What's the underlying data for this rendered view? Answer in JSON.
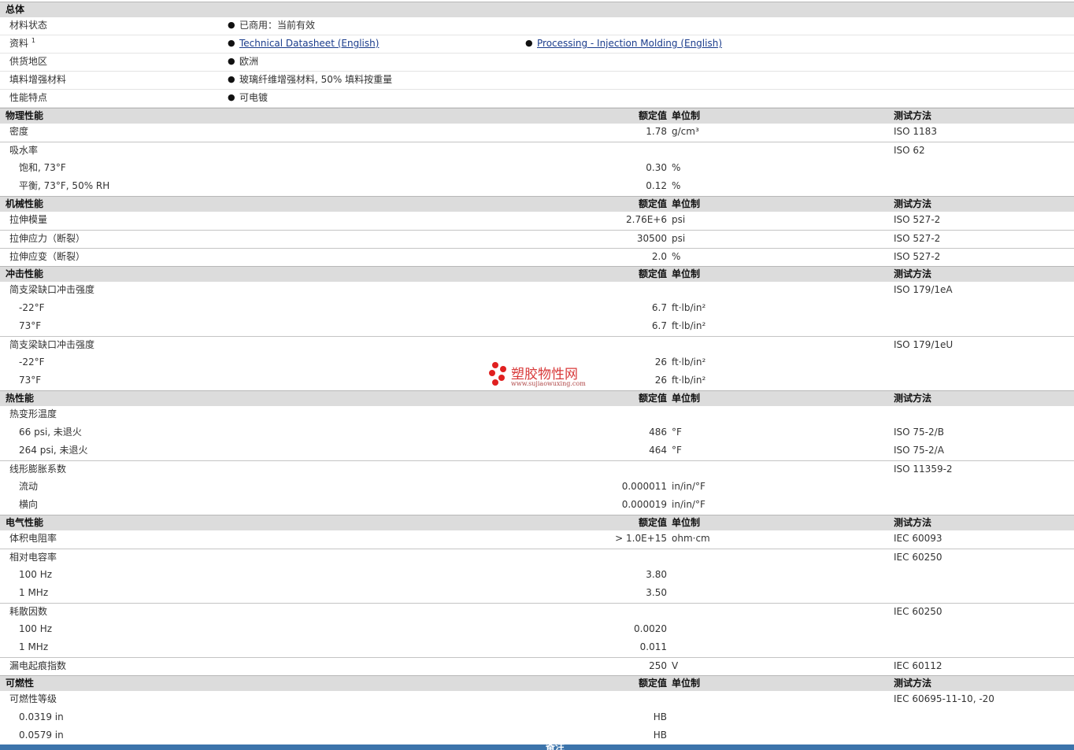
{
  "general": {
    "title": "总体",
    "rows": [
      {
        "label": "材料状态",
        "items": [
          "已商用：当前有效"
        ]
      },
      {
        "label": "资料",
        "sup": "1",
        "links": [
          "Technical Datasheet (English)",
          "Processing - Injection Molding (English)"
        ]
      },
      {
        "label": "供货地区",
        "items": [
          "欧洲"
        ]
      },
      {
        "label": "填料增强材料",
        "items": [
          "玻璃纤维增强材料, 50% 填料按重量"
        ]
      },
      {
        "label": "性能特点",
        "items": [
          "可电镀"
        ]
      }
    ]
  },
  "columns": {
    "value": "额定值",
    "unit": "单位制",
    "method": "测试方法"
  },
  "bullet_icon": "bullet-dot-icon",
  "sections": [
    {
      "title": "物理性能",
      "rows": [
        {
          "name": "密度",
          "value": "1.78",
          "unit": "g/cm³",
          "method": "ISO 1183"
        },
        {
          "name": "吸水率",
          "method": "ISO 62"
        },
        {
          "name": "饱和, 73°F",
          "sub": true,
          "value": "0.30",
          "unit": "%"
        },
        {
          "name": "平衡, 73°F, 50% RH",
          "sub": true,
          "value": "0.12",
          "unit": "%"
        }
      ]
    },
    {
      "title": "机械性能",
      "rows": [
        {
          "name": "拉伸模量",
          "value": "2.76E+6",
          "unit": "psi",
          "method": "ISO 527-2"
        },
        {
          "name": "拉伸应力（断裂）",
          "value": "30500",
          "unit": "psi",
          "method": "ISO 527-2"
        },
        {
          "name": "拉伸应变（断裂）",
          "value": "2.0",
          "unit": "%",
          "method": "ISO 527-2"
        }
      ]
    },
    {
      "title": "冲击性能",
      "rows": [
        {
          "name": "简支梁缺口冲击强度",
          "method": "ISO 179/1eA"
        },
        {
          "name": "-22°F",
          "sub": true,
          "value": "6.7",
          "unit": "ft·lb/in²"
        },
        {
          "name": "73°F",
          "sub": true,
          "value": "6.7",
          "unit": "ft·lb/in²"
        },
        {
          "name": "简支梁缺口冲击强度",
          "method": "ISO 179/1eU"
        },
        {
          "name": "-22°F",
          "sub": true,
          "value": "26",
          "unit": "ft·lb/in²"
        },
        {
          "name": "73°F",
          "sub": true,
          "value": "26",
          "unit": "ft·lb/in²"
        }
      ]
    },
    {
      "title": "热性能",
      "rows": [
        {
          "name": "热变形温度"
        },
        {
          "name": "66 psi, 未退火",
          "sub": true,
          "value": "486",
          "unit": "°F",
          "method": "ISO 75-2/B"
        },
        {
          "name": "264 psi, 未退火",
          "sub": true,
          "value": "464",
          "unit": "°F",
          "method": "ISO 75-2/A"
        },
        {
          "name": "线形膨胀系数",
          "method": "ISO 11359-2"
        },
        {
          "name": "流动",
          "sub": true,
          "value": "0.000011",
          "unit": "in/in/°F"
        },
        {
          "name": "横向",
          "sub": true,
          "value": "0.000019",
          "unit": "in/in/°F"
        }
      ]
    },
    {
      "title": "电气性能",
      "rows": [
        {
          "name": "体积电阻率",
          "value": "> 1.0E+15",
          "unit": "ohm·cm",
          "method": "IEC 60093"
        },
        {
          "name": "相对电容率",
          "method": "IEC 60250"
        },
        {
          "name": "100 Hz",
          "sub": true,
          "value": "3.80"
        },
        {
          "name": "1 MHz",
          "sub": true,
          "value": "3.50"
        },
        {
          "name": "耗散因数",
          "method": "IEC 60250"
        },
        {
          "name": "100 Hz",
          "sub": true,
          "value": "0.0020"
        },
        {
          "name": "1 MHz",
          "sub": true,
          "value": "0.011"
        },
        {
          "name": "漏电起痕指数",
          "value": "250",
          "unit": "V",
          "method": "IEC 60112"
        }
      ]
    },
    {
      "title": "可燃性",
      "rows": [
        {
          "name": "可燃性等级",
          "method": "IEC 60695-11-10, -20"
        },
        {
          "name": "0.0319 in",
          "sub": true,
          "value": "HB"
        },
        {
          "name": "0.0579 in",
          "sub": true,
          "value": "HB"
        }
      ]
    }
  ],
  "watermark": {
    "name": "塑胶物性网",
    "url": "www.sujiaowuxing.com"
  },
  "footer": {
    "label": "备注"
  }
}
